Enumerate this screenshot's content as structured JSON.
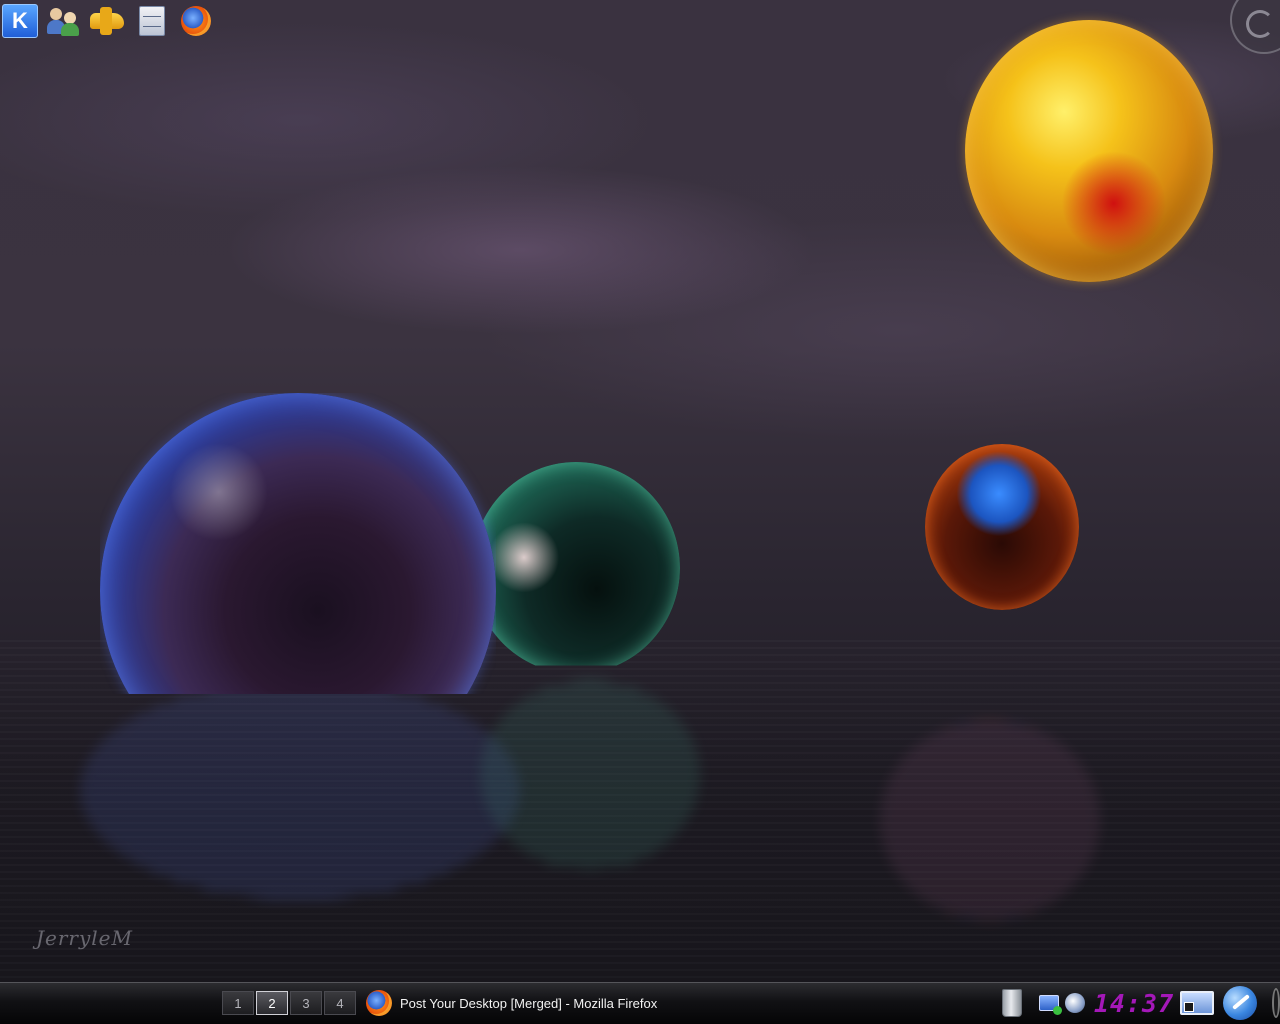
{
  "wallpaper": {
    "signature": "JerryleM",
    "colors": {
      "sky": "#3a3240",
      "water": "#1b1a20",
      "blue_sphere": "#2440b0",
      "green_sphere": "#1f6a58",
      "gold_sphere": "#f5c21a",
      "orange_sphere": "#b0400e"
    }
  },
  "taskbar": {
    "kmenu_label": "K",
    "launchers": [
      {
        "icon": "users-icon"
      },
      {
        "icon": "plane-icon"
      },
      {
        "icon": "file-cabinet-icon"
      },
      {
        "icon": "firefox-icon"
      }
    ],
    "pager": {
      "desktops": [
        "1",
        "2",
        "3",
        "4"
      ],
      "active": "2"
    },
    "tasks": [
      {
        "icon": "firefox-icon",
        "title": "Post Your Desktop [Merged] - Mozilla Firefox"
      }
    ],
    "tray": {
      "clock": "14:37",
      "icons": [
        "trash-icon",
        "network-icon",
        "system-icon",
        "show-desktop-icon",
        "logout-icon"
      ]
    },
    "accent_color": "#a418b8"
  }
}
